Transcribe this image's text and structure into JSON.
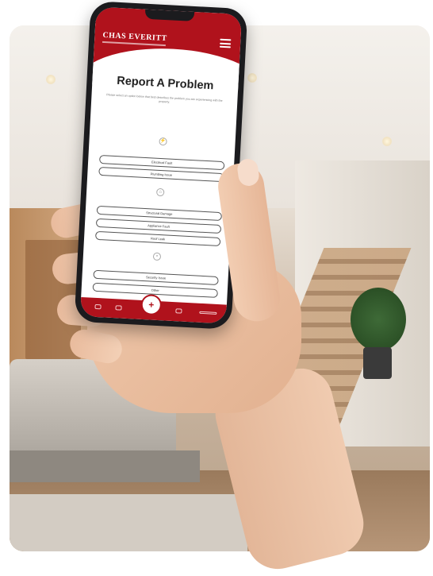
{
  "app": {
    "brand": "CHAS EVERITT",
    "page_title": "Report A Problem",
    "description": "Please select an option below that best describes the problem you are experiencing with the property."
  },
  "sections": [
    {
      "icon": "plug-icon",
      "label": "",
      "options": [
        "Electrical Fault",
        "Plumbing Issue"
      ]
    },
    {
      "icon": "house-icon",
      "label": "",
      "options": [
        "Structural Damage",
        "Appliance Fault",
        "Roof Leak"
      ]
    },
    {
      "icon": "lock-icon",
      "label": "",
      "options": [
        "Security Issue",
        "Other"
      ]
    }
  ],
  "tabbar": {
    "items": [
      "home-icon",
      "wrench-icon",
      "calendar-icon",
      "profile-icon"
    ],
    "fab_icon": "plus-icon"
  },
  "colors": {
    "brand_red": "#b0121c",
    "background": "#ffffff"
  }
}
